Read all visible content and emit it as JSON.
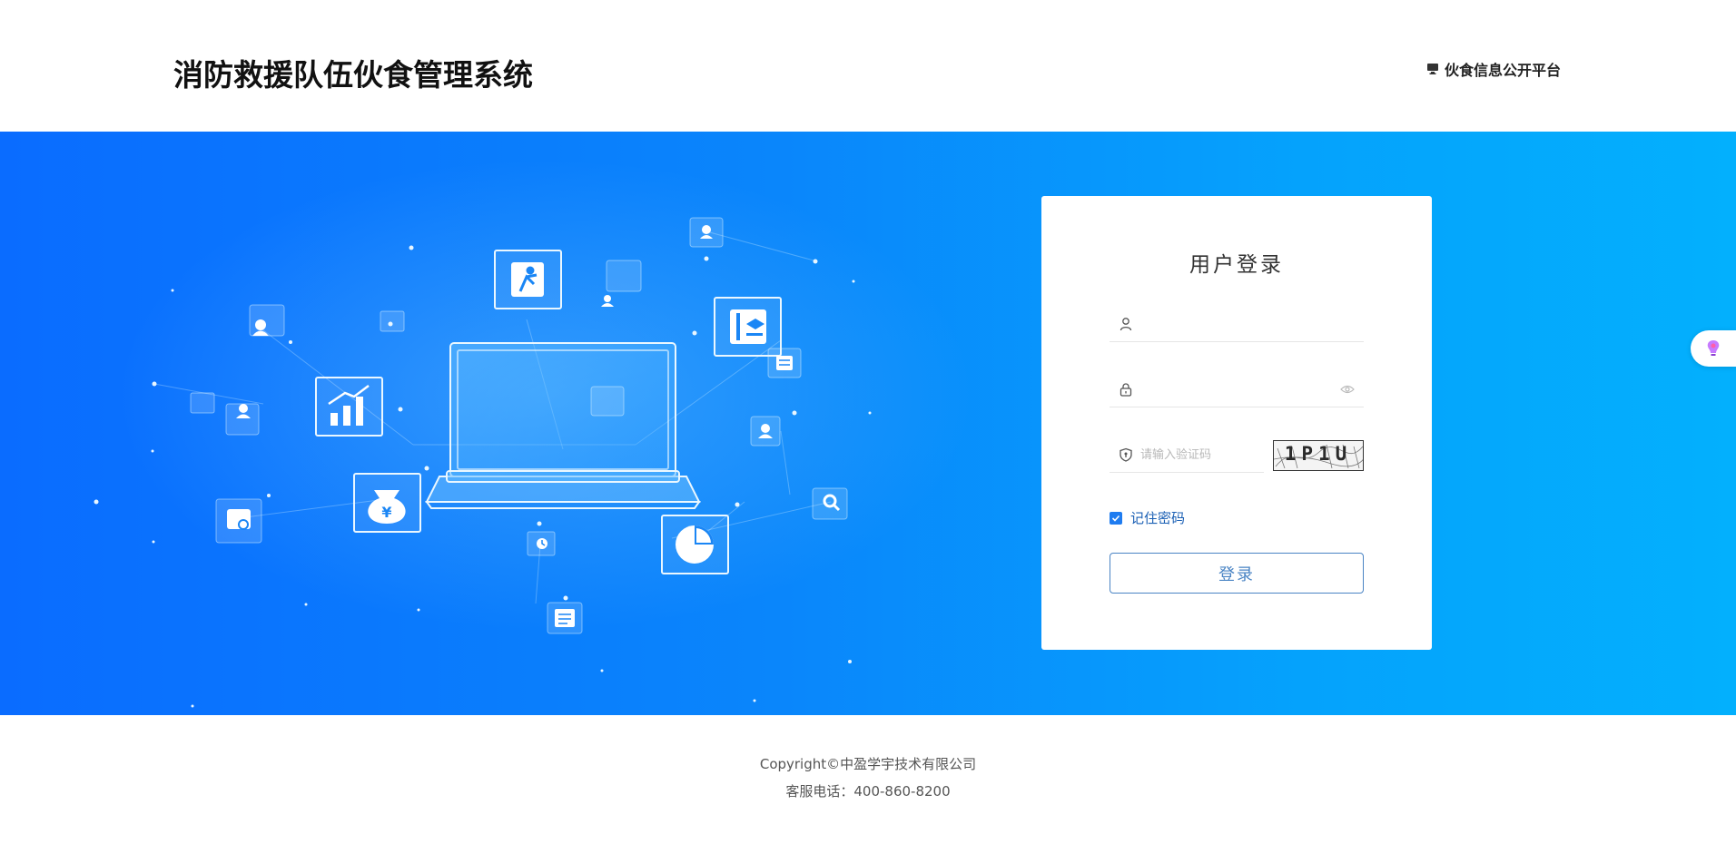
{
  "header": {
    "system_title": "消防救援队伍伙食管理系统",
    "platform_link_label": "伙食信息公开平台",
    "platform_icon": "monitor-icon"
  },
  "login": {
    "title": "用户登录",
    "username": {
      "value": "",
      "placeholder": "",
      "icon": "user-icon"
    },
    "password": {
      "value": "",
      "placeholder": "",
      "icon": "lock-icon",
      "toggle_icon": "eye-icon"
    },
    "captcha": {
      "value": "",
      "placeholder": "请输入验证码",
      "icon": "shield-icon",
      "image_text": "1P1U"
    },
    "remember_label": "记住密码",
    "remember_checked": true,
    "submit_label": "登录"
  },
  "side_tab": {
    "icon": "lightbulb-icon"
  },
  "footer": {
    "copyright": "Copyright©中盈学宇技术有限公司",
    "phone": "客服电话：400-860-8200"
  },
  "colors": {
    "banner_start": "#0a6cff",
    "banner_end": "#03b0fd",
    "accent": "#1f7cf0",
    "button_border": "#4a84c4"
  }
}
